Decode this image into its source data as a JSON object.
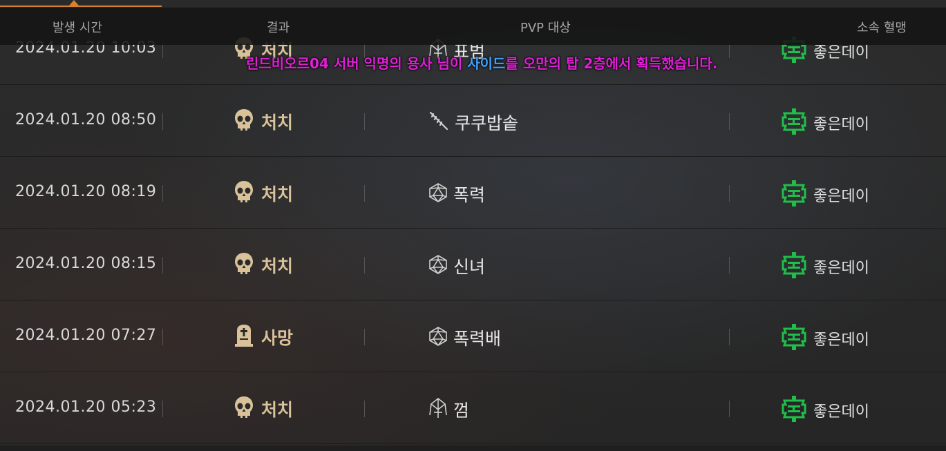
{
  "header": {
    "time": "발생 시간",
    "result": "결과",
    "target": "PVP 대상",
    "clan": "소속 혈맹"
  },
  "notice": {
    "prefix": "린드비오르04 서버 익명의 용사 님이 ",
    "item": "사이드",
    "suffix": "를 오만의 탑 2층에서 획득했습니다."
  },
  "colors": {
    "accent": "#d6802e",
    "notice": "#e01fd6",
    "notice_item": "#3ea3ff",
    "result_text": "#d9c29a",
    "clan_emblem": "#1fbf4a"
  },
  "rows": [
    {
      "time": "2024.01.20 10:03",
      "result": "처치",
      "result_icon": "skull-icon",
      "target_icon": "rune-icon",
      "target": "표범",
      "clan": "좋은데이"
    },
    {
      "time": "2024.01.20 08:50",
      "result": "처치",
      "result_icon": "skull-icon",
      "target_icon": "spear-icon",
      "target": "쿠쿠밥솥",
      "clan": "좋은데이"
    },
    {
      "time": "2024.01.20 08:19",
      "result": "처치",
      "result_icon": "skull-icon",
      "target_icon": "polyhedron-icon",
      "target": "폭력",
      "clan": "좋은데이"
    },
    {
      "time": "2024.01.20 08:15",
      "result": "처치",
      "result_icon": "skull-icon",
      "target_icon": "polyhedron-icon",
      "target": "신녀",
      "clan": "좋은데이"
    },
    {
      "time": "2024.01.20 07:27",
      "result": "사망",
      "result_icon": "tombstone-icon",
      "target_icon": "polyhedron-icon",
      "target": "폭력배",
      "clan": "좋은데이"
    },
    {
      "time": "2024.01.20 05:23",
      "result": "처치",
      "result_icon": "skull-icon",
      "target_icon": "rune-icon",
      "target": "껌",
      "clan": "좋은데이"
    }
  ]
}
